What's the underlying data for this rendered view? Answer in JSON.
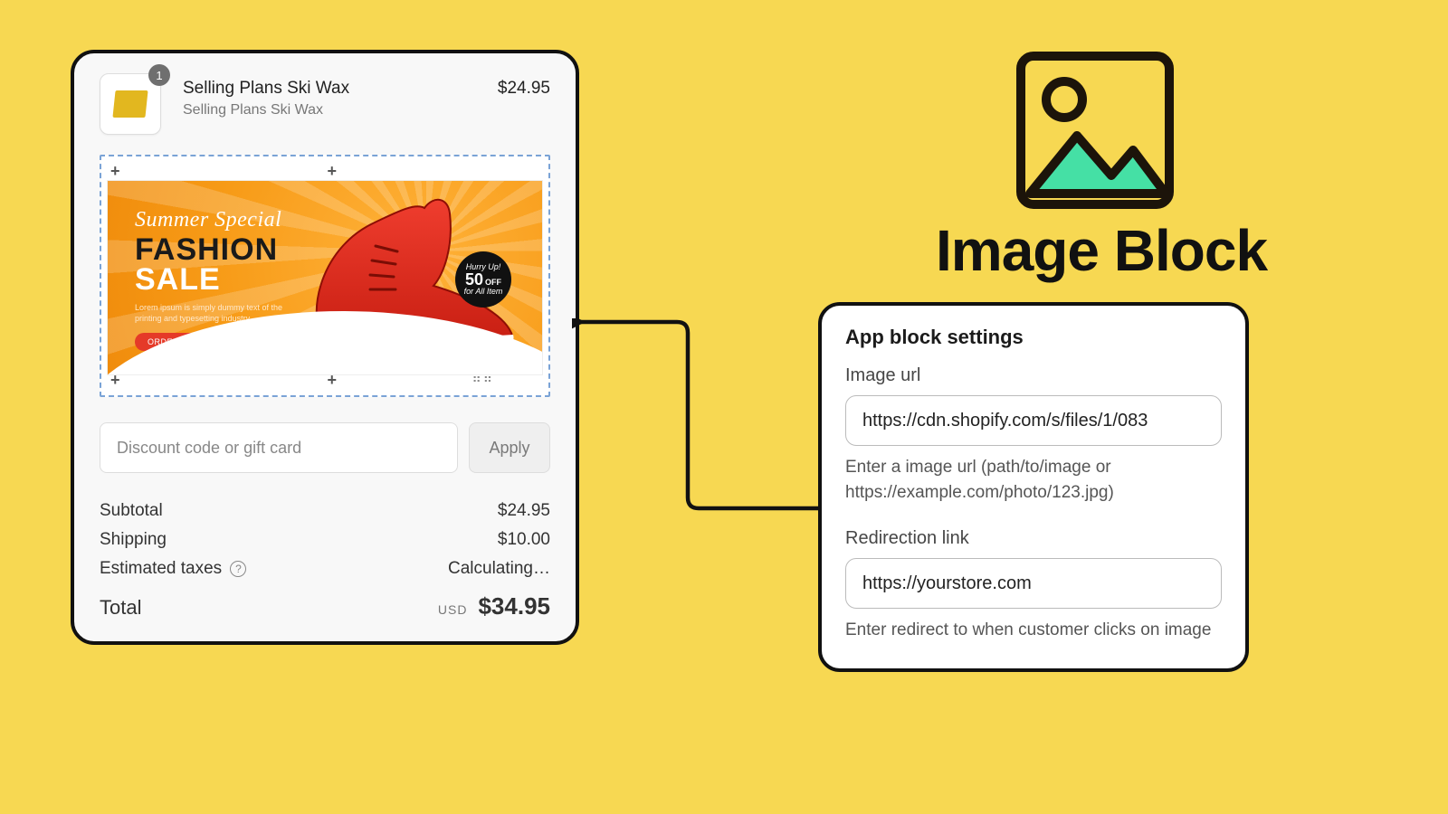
{
  "colors": {
    "page_bg": "#f7d852",
    "card_bg": "#f8f8f8",
    "border": "#111111"
  },
  "cart": {
    "qty_badge": "1",
    "title": "Selling Plans Ski Wax",
    "subtitle": "Selling Plans Ski Wax",
    "price": "$24.95"
  },
  "banner": {
    "script": "Summer Special",
    "line1": "FASHION",
    "line2": "SALE",
    "lorem": "Lorem ipsum is simply dummy text of the printing and typesetting industry.",
    "cta": "ORDER NOW",
    "tag_top": "Hurry Up!",
    "tag_pct": "50",
    "tag_off": "OFF",
    "tag_sub": "for All Item"
  },
  "discount": {
    "placeholder": "Discount code or gift card",
    "apply_label": "Apply"
  },
  "summary": {
    "subtotal_label": "Subtotal",
    "subtotal_value": "$24.95",
    "shipping_label": "Shipping",
    "shipping_value": "$10.00",
    "taxes_label": "Estimated taxes",
    "taxes_value": "Calculating…",
    "total_label": "Total",
    "currency": "USD",
    "total_value": "$34.95"
  },
  "right": {
    "title": "Image Block"
  },
  "settings": {
    "heading": "App block settings",
    "image_url_label": "Image url",
    "image_url_value": "https://cdn.shopify.com/s/files/1/083",
    "image_url_help": "Enter a image url (path/to/image or https://example.com/photo/123.jpg)",
    "redirect_label": "Redirection link",
    "redirect_value": "https://yourstore.com",
    "redirect_help": "Enter redirect to when customer clicks on image"
  }
}
